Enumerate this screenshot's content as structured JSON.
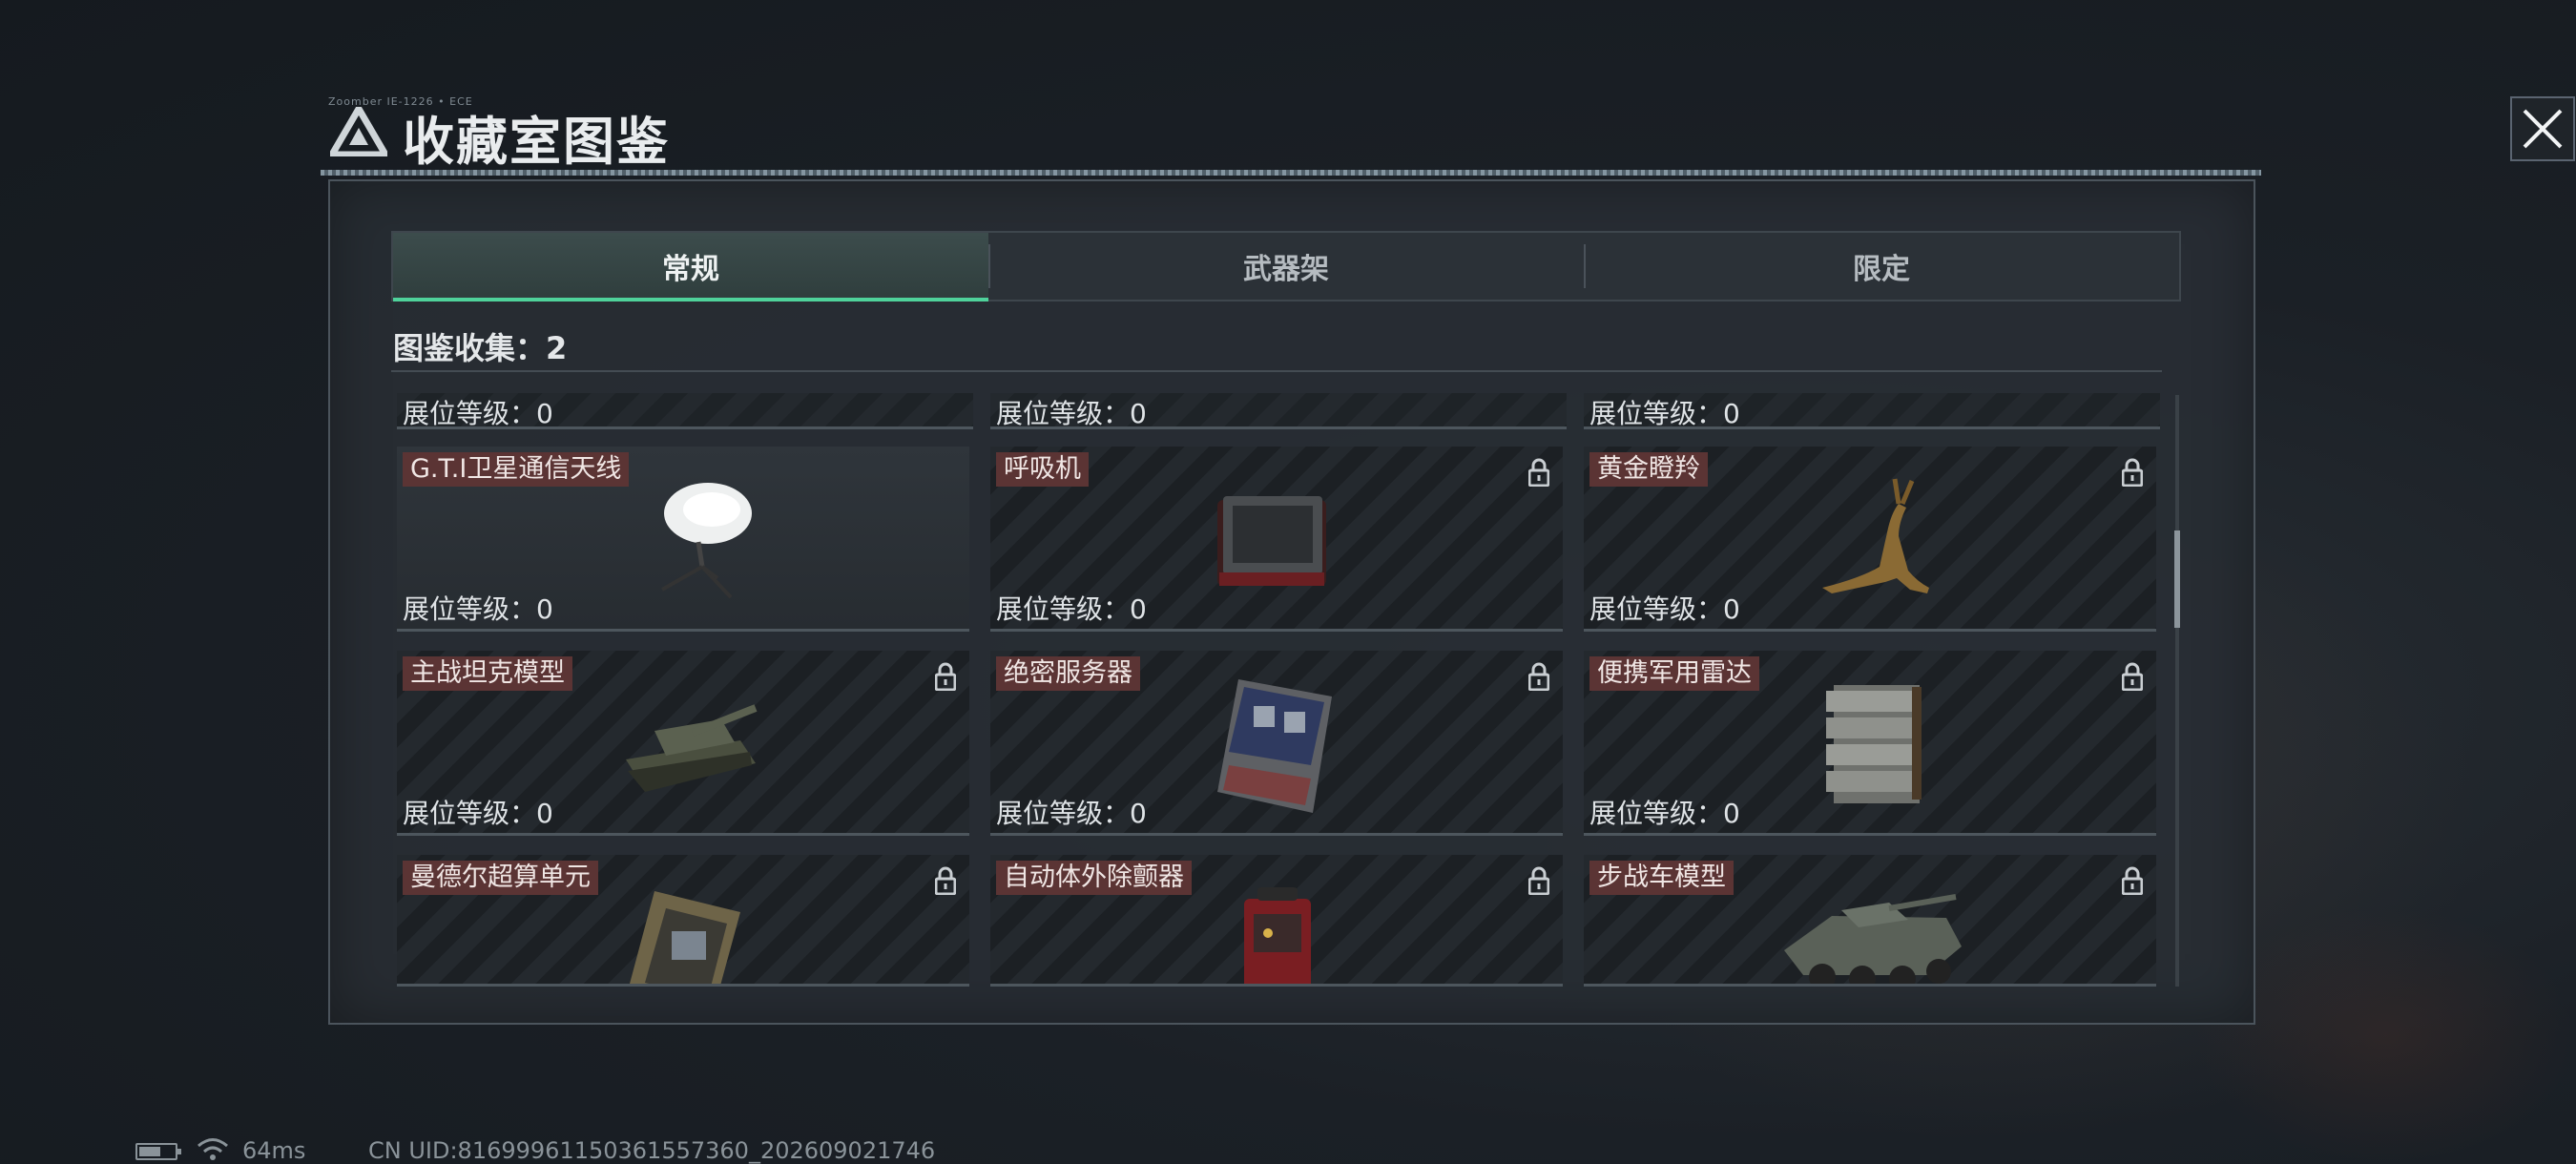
{
  "header": {
    "title": "收藏室图鉴",
    "tiny_text": "Zoomber IE-1226 • ECE",
    "logo_icon": "triangle-logo-icon",
    "close_icon": "close-icon"
  },
  "tabs": [
    {
      "label": "常规",
      "active": true
    },
    {
      "label": "武器架",
      "active": false
    },
    {
      "label": "限定",
      "active": false
    }
  ],
  "collection": {
    "label": "图鉴收集：2"
  },
  "top_row_levels": [
    {
      "level_label": "展位等级：0"
    },
    {
      "level_label": "展位等级：0"
    },
    {
      "level_label": "展位等级：0"
    }
  ],
  "items": [
    {
      "name": "G.T.I卫星通信天线",
      "level_label": "展位等级：0",
      "locked": false,
      "icon": "satellite-dish-icon"
    },
    {
      "name": "呼吸机",
      "level_label": "展位等级：0",
      "locked": true,
      "icon": "ventilator-icon"
    },
    {
      "name": "黄金瞪羚",
      "level_label": "展位等级：0",
      "locked": true,
      "icon": "golden-gazelle-icon"
    },
    {
      "name": "主战坦克模型",
      "level_label": "展位等级：0",
      "locked": true,
      "icon": "tank-model-icon"
    },
    {
      "name": "绝密服务器",
      "level_label": "展位等级：0",
      "locked": true,
      "icon": "server-icon"
    },
    {
      "name": "便携军用雷达",
      "level_label": "展位等级：0",
      "locked": true,
      "icon": "radar-icon"
    },
    {
      "name": "曼德尔超算单元",
      "level_label": "",
      "locked": true,
      "icon": "supercomputer-unit-icon"
    },
    {
      "name": "自动体外除颤器",
      "level_label": "",
      "locked": true,
      "icon": "defibrillator-icon"
    },
    {
      "name": "步战车模型",
      "level_label": "",
      "locked": true,
      "icon": "ifv-model-icon"
    }
  ],
  "status_bar": {
    "battery_level": 0.6,
    "ping": "64ms",
    "uid": "CN UID:816999611503615573​60_202609021746"
  },
  "colors": {
    "accent": "#4fd39b",
    "name_tag": "#5b3434",
    "panel": "#282e34"
  }
}
